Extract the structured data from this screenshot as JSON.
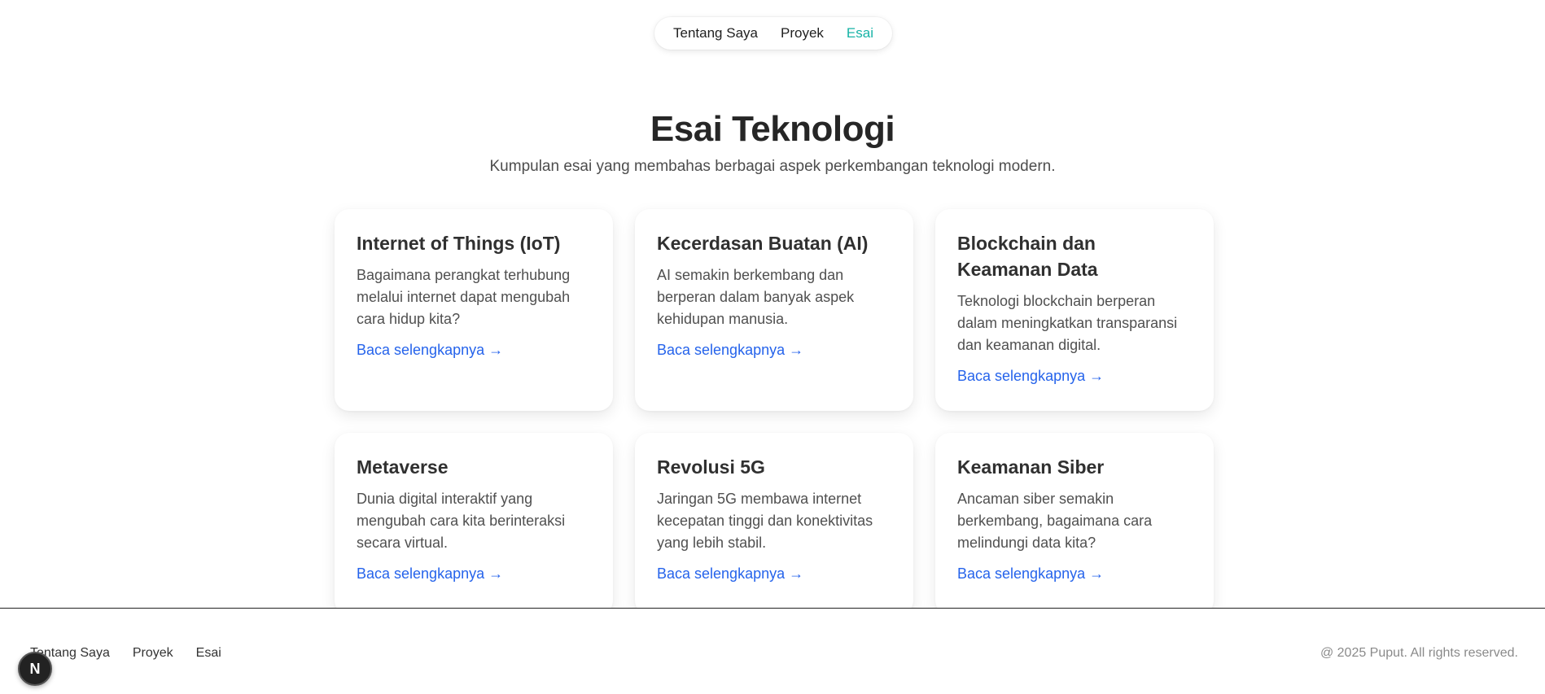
{
  "nav": {
    "items": [
      {
        "label": "Tentang Saya"
      },
      {
        "label": "Proyek"
      },
      {
        "label": "Esai"
      }
    ]
  },
  "hero": {
    "title": "Esai Teknologi",
    "subtitle": "Kumpulan esai yang membahas berbagai aspek perkembangan teknologi modern."
  },
  "cards": [
    {
      "title": "Internet of Things (IoT)",
      "desc": "Bagaimana perangkat terhubung melalui internet dapat mengubah cara hidup kita?",
      "link": "Baca selengkapnya →"
    },
    {
      "title": "Kecerdasan Buatan (AI)",
      "desc": "AI semakin berkembang dan berperan dalam banyak aspek kehidupan manusia.",
      "link": "Baca selengkapnya →"
    },
    {
      "title": "Blockchain dan Keamanan Data",
      "desc": "Teknologi blockchain berperan dalam meningkatkan transparansi dan keamanan digital.",
      "link": "Baca selengkapnya →"
    },
    {
      "title": "Metaverse",
      "desc": "Dunia digital interaktif yang mengubah cara kita berinteraksi secara virtual.",
      "link": "Baca selengkapnya →"
    },
    {
      "title": "Revolusi 5G",
      "desc": "Jaringan 5G membawa internet kecepatan tinggi dan konektivitas yang lebih stabil.",
      "link": "Baca selengkapnya →"
    },
    {
      "title": "Keamanan Siber",
      "desc": "Ancaman siber semakin berkembang, bagaimana cara melindungi data kita?",
      "link": "Baca selengkapnya →"
    }
  ],
  "footer": {
    "links": [
      {
        "label": "Tentang Saya"
      },
      {
        "label": "Proyek"
      },
      {
        "label": "Esai"
      }
    ],
    "copyright": "@ 2025 Puput. All rights reserved."
  },
  "badge": {
    "letter": "N"
  }
}
